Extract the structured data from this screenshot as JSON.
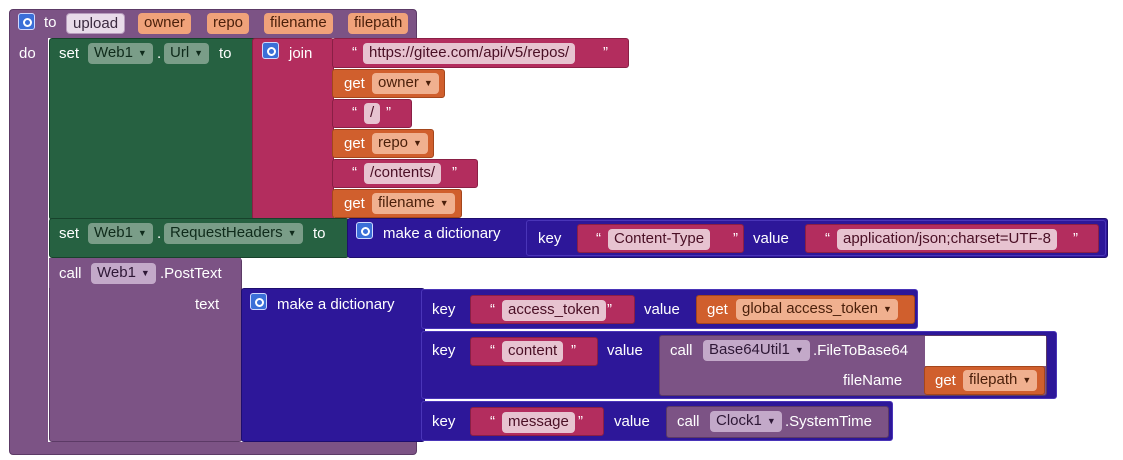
{
  "procedure": {
    "keyword": "to",
    "name": "upload",
    "params": [
      "owner",
      "repo",
      "filename",
      "filepath"
    ],
    "do_label": "do"
  },
  "set_url": {
    "set_word": "set",
    "component": "Web1",
    "dot": ".",
    "property": "Url",
    "to_word": "to",
    "join_label": "join",
    "url_base": "https://gitee.com/api/v5/repos/",
    "get_word": "get",
    "owner_var": "owner",
    "slash": "/",
    "repo_var": "repo",
    "contents_path": "/contents/",
    "filename_var": "filename"
  },
  "set_headers": {
    "set_word": "set",
    "component": "Web1",
    "dot": ".",
    "property": "RequestHeaders",
    "to_word": "to",
    "make_dict_label": "make a dictionary",
    "key_label": "key",
    "key_value": "Content-Type",
    "value_label": "value",
    "value_value": "application/json;charset=UTF-8"
  },
  "post_call": {
    "call_word": "call",
    "component": "Web1",
    "method": ".PostText",
    "text_label": "text",
    "make_dict_label": "make a dictionary",
    "pair1": {
      "key_label": "key",
      "key": "access_token",
      "value_label": "value",
      "get_word": "get",
      "var": "global access_token"
    },
    "pair2": {
      "key_label": "key",
      "key": "content",
      "value_label": "value",
      "call_word": "call",
      "component": "Base64Util1",
      "method": ".FileToBase64",
      "arg_label": "fileName",
      "get_word": "get",
      "var": "filepath"
    },
    "pair3": {
      "key_label": "key",
      "key": "message",
      "value_label": "value",
      "call_word": "call",
      "component": "Clock1",
      "method": ".SystemTime"
    }
  },
  "quote_open": "“",
  "quote_close": "”",
  "colors": {
    "procedure": "#7c5385",
    "procedure_param": "#f0a27a",
    "web_setter": "#266141",
    "text_string": "#b32d5e",
    "variable_get": "#d05f2d",
    "dictionary": "#2d1799",
    "component_call": "#7c5385"
  }
}
